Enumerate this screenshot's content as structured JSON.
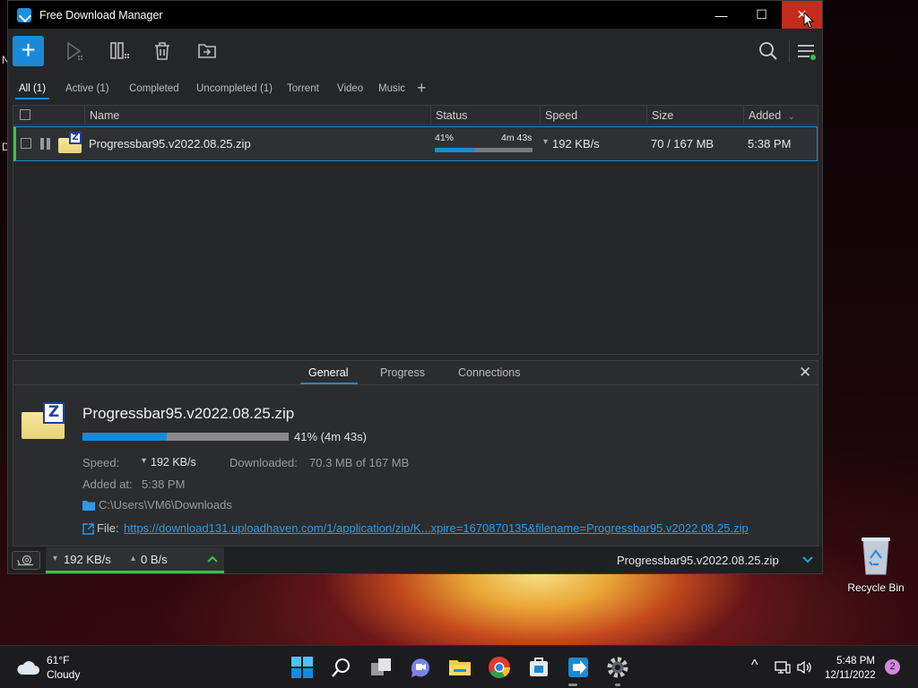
{
  "window": {
    "title": "Free Download Manager",
    "controls": {
      "minimize": "—",
      "maximize": "☐",
      "close": "✕"
    }
  },
  "desktop_peek": {
    "left_letter_1": "N",
    "left_letter_2": "D"
  },
  "toolbar": {
    "add_label": "+",
    "icons": [
      "play-icon",
      "columns-icon",
      "trash-icon",
      "move-folder-icon",
      "search-icon",
      "menu-icon"
    ]
  },
  "filters": [
    {
      "label": "All (1)",
      "active": true
    },
    {
      "label": "Active (1)"
    },
    {
      "label": "Completed"
    },
    {
      "label": "Uncompleted (1)"
    },
    {
      "label": "Torrent"
    },
    {
      "label": "Video"
    },
    {
      "label": "Music"
    }
  ],
  "filter_add": "+",
  "list": {
    "columns": [
      "Name",
      "Status",
      "Speed",
      "Size",
      "Added"
    ],
    "sort_indicator": "⌄",
    "rows": [
      {
        "name": "Progressbar95.v2022.08.25.zip",
        "percent": "41%",
        "eta": "4m 43s",
        "progress": 0.41,
        "speed_arrow": "▾",
        "speed": "192 KB/s",
        "size": "70 / 167 MB",
        "added": "5:38 PM",
        "icon_badge": "Z"
      }
    ]
  },
  "details": {
    "tabs": [
      "General",
      "Progress",
      "Connections"
    ],
    "active_tab": "General",
    "close": "✕",
    "file_name": "Progressbar95.v2022.08.25.zip",
    "progress": 0.41,
    "progress_text": "41% (4m 43s)",
    "speed_label": "Speed:",
    "speed_arrow": "▾",
    "speed_value": "192 KB/s",
    "downloaded_label": "Downloaded:",
    "downloaded_value": "70.3 MB of 167 MB",
    "added_label": "Added at:",
    "added_value": "5:38 PM",
    "folder_path": "C:\\Users\\VM6\\Downloads",
    "file_label": "File:",
    "file_url": "https://download131.uploadhaven.com/1/application/zip/K...xpire=1670870135&filename=Progressbar95.v2022.08.25.zip",
    "icon_badge": "Z"
  },
  "statusbar": {
    "down_arrow": "▾",
    "down_speed": "192 KB/s",
    "up_arrow": "▴",
    "up_speed": "0 B/s",
    "current_file": "Progressbar95.v2022.08.25.zip"
  },
  "desktop": {
    "recycle_bin": "Recycle Bin"
  },
  "taskbar": {
    "temperature": "61°F",
    "condition": "Cloudy",
    "time": "5:48 PM",
    "date": "12/11/2022",
    "notifications": "2",
    "tray_chevron": "^",
    "apps": [
      "windows-start-icon",
      "search-icon",
      "task-view-icon",
      "chat-icon",
      "file-explorer-icon",
      "chrome-icon",
      "store-icon",
      "fdm-icon",
      "settings-icon"
    ]
  },
  "colors": {
    "accent": "#1a8ad8",
    "active_green": "#3cc24a",
    "close_red": "#c42b1c",
    "background": "#252627"
  }
}
